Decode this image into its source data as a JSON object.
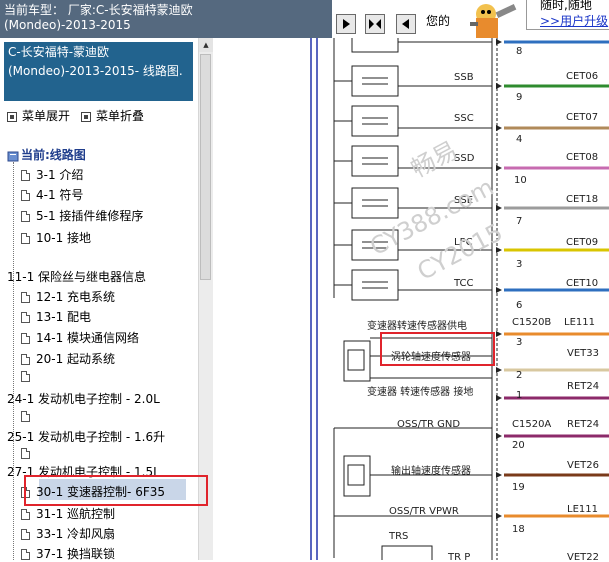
{
  "header": {
    "line1": "当前车型： 厂家:C-长安福特蒙迪欧",
    "line2": "(Mondeo)-2013-2015"
  },
  "ad": {
    "text1": "您的",
    "box_line1": "随时,随地",
    "box_link": ">>用户升级"
  },
  "sidebar": {
    "title": "C-长安福特-蒙迪欧(Mondeo)-2013-2015- 线路图.",
    "expand_label": "菜单展开",
    "collapse_label": "菜单折叠",
    "root": "当前:线路图",
    "items": [
      "3-1 介绍",
      "4-1 符号",
      "5-1 接插件维修程序",
      "10-1 接地",
      "11-1 保险丝与继电器信息",
      "12-1 充电系统",
      "13-1 配电",
      "14-1 模块通信网络",
      "20-1 起动系统",
      "24-1 发动机电子控制 - 2.0L",
      "25-1 发动机电子控制 - 1.6升",
      "27-1 发动机电子控制 - 1.5L",
      "30-1 变速器控制- 6F35",
      "31-1 巡航控制",
      "33-1 冷却风扇",
      "37-1 换挡联锁"
    ]
  },
  "diagram": {
    "solenoids": [
      "SSB",
      "SSC",
      "SSD",
      "SSE",
      "LPC",
      "TCC"
    ],
    "wires": [
      {
        "label": "CET06",
        "pin": "9",
        "color": "#2e8b2e"
      },
      {
        "label": "CET07",
        "pin": "4",
        "color": "#b08a5a"
      },
      {
        "label": "CET08",
        "pin": "10",
        "color": "#c76bb0"
      },
      {
        "label": "CET18",
        "pin": "7",
        "color": "#9c9c9c"
      },
      {
        "label": "CET09",
        "pin": "3",
        "color": "#d9c500"
      },
      {
        "label": "CET10",
        "pin": "6",
        "color": "#2e6fbf"
      }
    ],
    "top_pin": "8",
    "connector1": "C1520B",
    "le111": "LE111",
    "speed_sensor_power": "变速器转速传感器供电",
    "turbine_sensor": "涡轮轴速度传感器",
    "speed_sensor_ground": "变速器 转速传感器 接地",
    "vet33": "VET33",
    "vet33_pin": "2",
    "ret24_a": "RET24",
    "ret24_a_pin": "1",
    "pin3": "3",
    "oss_gnd": "OSS/TR GND",
    "connector2": "C1520A",
    "ret24_b": "RET24",
    "pin20": "20",
    "output_sensor": "输出轴速度传感器",
    "vet26": "VET26",
    "vet26_pin": "19",
    "oss_vpwr": "OSS/TR VPWR",
    "le111_b": "LE111",
    "pin18": "18",
    "trs": "TRS",
    "trp": "TR P",
    "vet22": "VET22",
    "watermark1": "畅易",
    "watermark2": "CY388.com",
    "watermark3": "CY2015"
  }
}
